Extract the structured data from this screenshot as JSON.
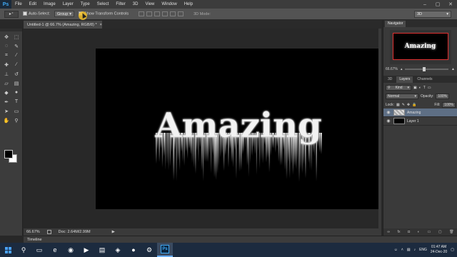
{
  "app": {
    "logo": "Ps"
  },
  "menu": [
    "File",
    "Edit",
    "Image",
    "Layer",
    "Type",
    "Select",
    "Filter",
    "3D",
    "View",
    "Window",
    "Help"
  ],
  "window_controls": [
    "–",
    "▢",
    "✕"
  ],
  "options": {
    "auto_select_label": "Auto-Select:",
    "auto_select_value": "Group",
    "show_transform_label": "Show Transform Controls",
    "mode_3d_label": "3D Mode:",
    "workspace": "3D"
  },
  "document": {
    "tab_title": "Untitled-1 @ 66.7% (Amazing, RGB/8) *",
    "canvas_text": "Amazing",
    "zoom": "66.67%",
    "doc_size": "Doc: 2.64M/2.99M"
  },
  "timeline_label": "Timeline",
  "navigator": {
    "tabs": [
      "Navigator"
    ],
    "zoom": "66.67%"
  },
  "layers_panel": {
    "tabs": [
      "3D",
      "Layers",
      "Channels"
    ],
    "filter": "Kind",
    "blend_mode": "Normal",
    "opacity_label": "Opacity:",
    "opacity_value": "100%",
    "lock_label": "Lock:",
    "fill_label": "Fill:",
    "fill_value": "100%",
    "layers": [
      {
        "name": "Amazing",
        "selected": true
      },
      {
        "name": "Layer 1",
        "selected": false
      }
    ],
    "footer_icons": [
      "link-icon",
      "fx-icon",
      "mask-icon",
      "adjustment-icon",
      "folder-icon",
      "new-layer-icon",
      "trash-icon"
    ]
  },
  "taskbar": {
    "language": "ENG",
    "time": "01:47 AM",
    "date": "24-Dec-20"
  },
  "colors": {
    "foreground": "#000000",
    "background": "#ffffff",
    "selection": "#5e6f85",
    "accent": "#3fa9f5"
  }
}
